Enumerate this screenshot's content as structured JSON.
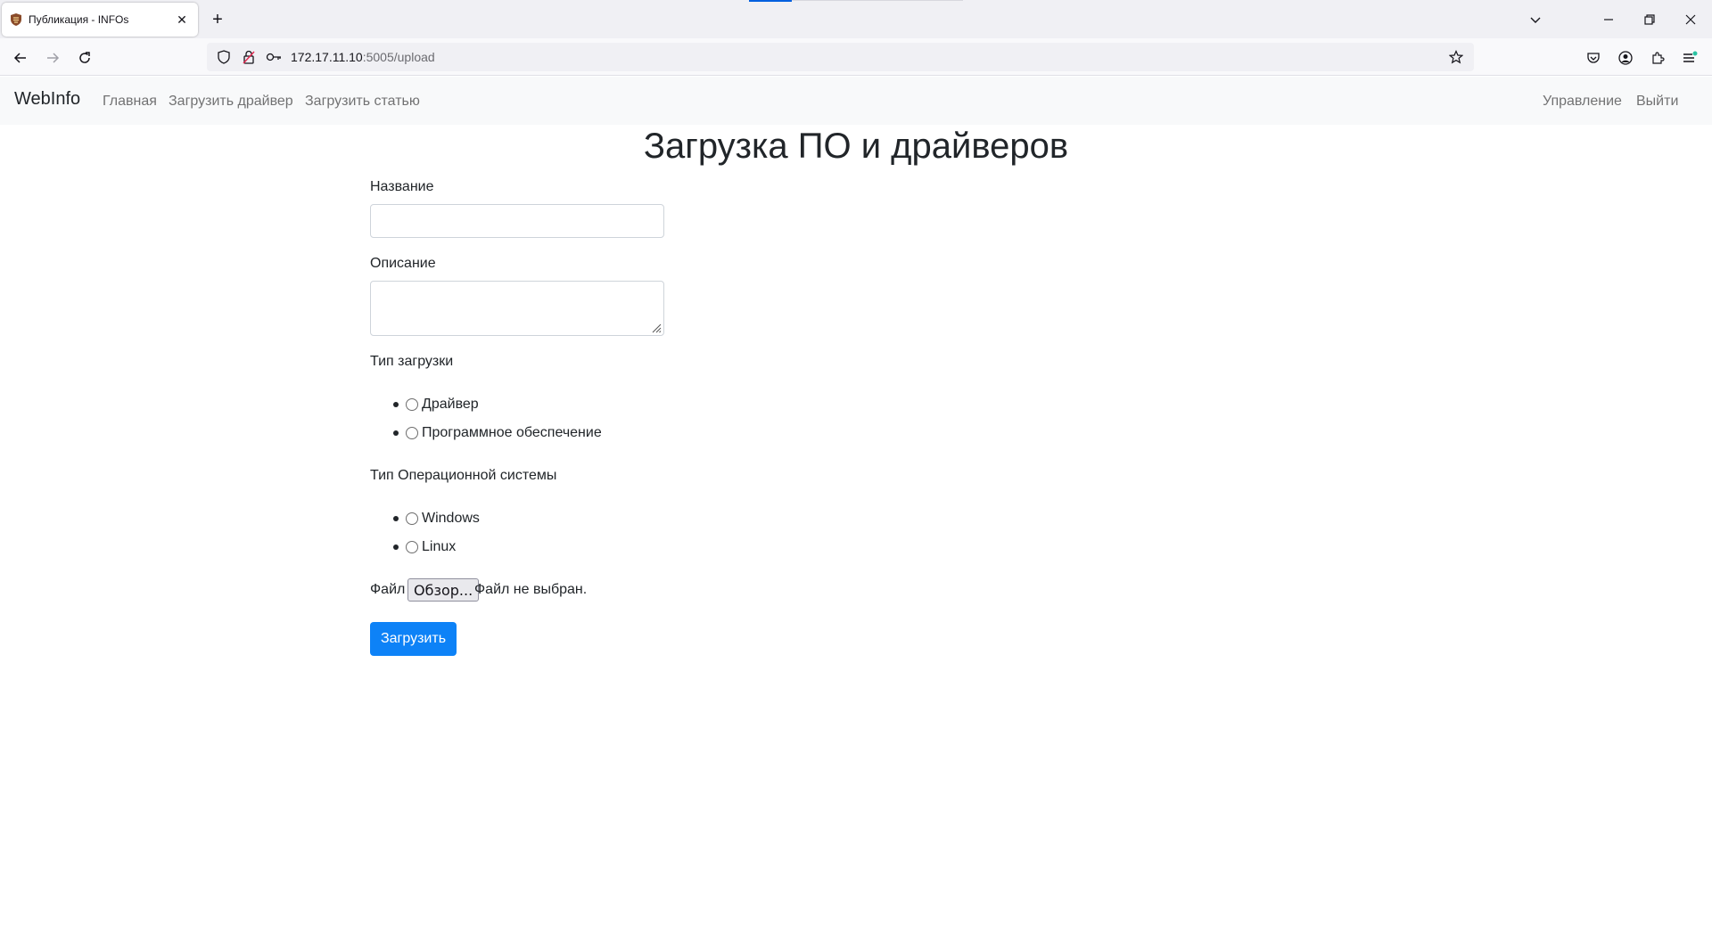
{
  "browser": {
    "tab_title": "Публикация - INFOs",
    "url_host": "172.17.11.10",
    "url_path": ":5005/upload"
  },
  "site": {
    "brand": "WebInfo",
    "nav_left": [
      "Главная",
      "Загрузить драйвер",
      "Загрузить статью"
    ],
    "nav_right": [
      "Управление",
      "Выйти"
    ]
  },
  "page": {
    "title": "Загрузка ПО и драйверов",
    "name_label": "Название",
    "name_value": "",
    "description_label": "Описание",
    "description_value": "",
    "upload_type_label": "Тип загрузки",
    "upload_type_options": [
      "Драйвер",
      "Программное обеспечение"
    ],
    "os_type_label": "Тип Операционной системы",
    "os_type_options": [
      "Windows",
      "Linux"
    ],
    "file_label": "Файл",
    "file_button": "Обзор...",
    "file_status": "Файл не выбран.",
    "submit_label": "Загрузить"
  },
  "colors": {
    "primary": "#0d82f7",
    "navbar_bg": "#f8f9fa",
    "browser_accent": "#0060df"
  }
}
